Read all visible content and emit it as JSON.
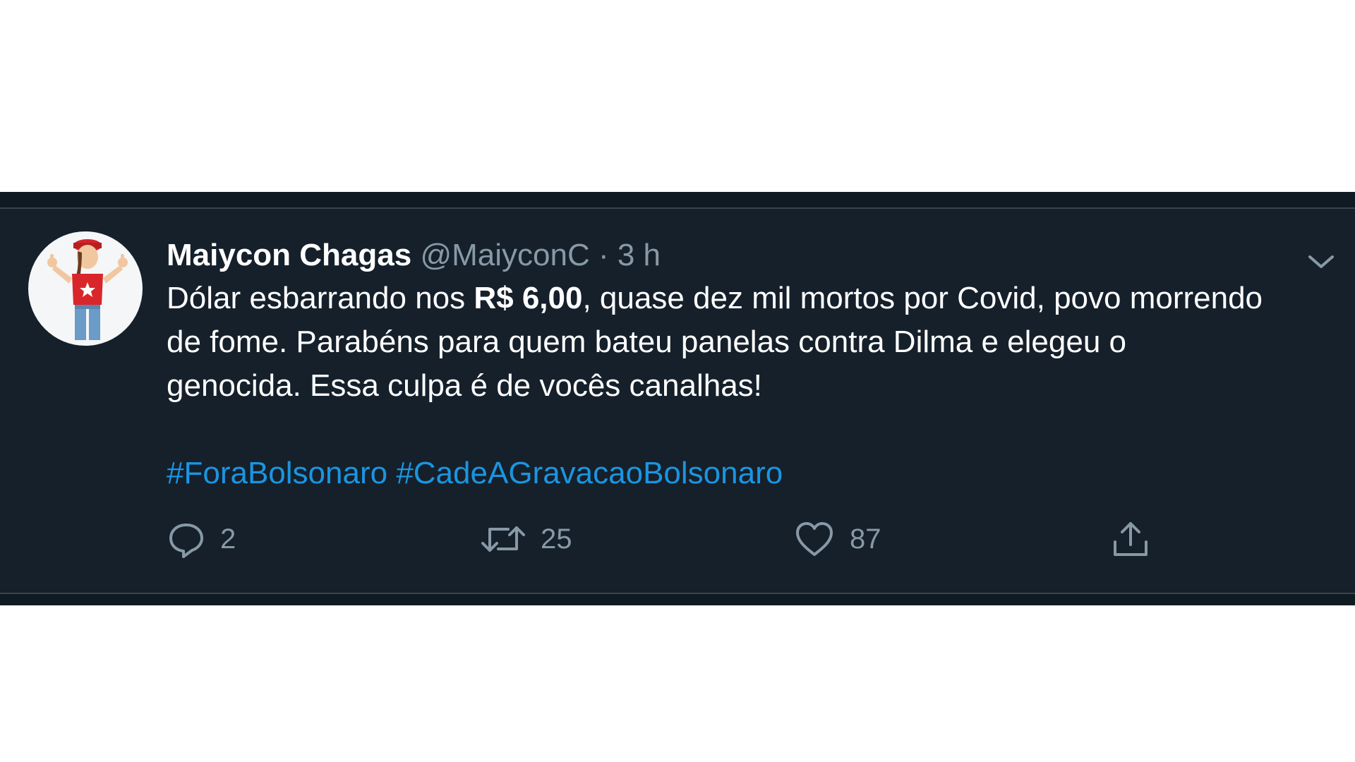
{
  "tweet": {
    "display_name": "Maiycon Chagas",
    "handle": "@MaiyconC",
    "separator": "·",
    "time": "3 h",
    "text_parts": {
      "p1": "Dólar esbarrando nos ",
      "bold": "R$ 6,00",
      "p2": ", quase dez mil mortos por Covid, povo morrendo de fome. Parabéns para quem bateu panelas contra Dilma e elegeu o genocida. Essa culpa é de vocês canalhas!"
    },
    "hashtags": [
      "#ForaBolsonaro",
      "#CadeAGravacaoBolsonaro"
    ],
    "actions": {
      "reply_count": "2",
      "retweet_count": "25",
      "like_count": "87"
    }
  },
  "icons": {
    "reply": "reply-icon",
    "retweet": "retweet-icon",
    "like": "heart-icon",
    "share": "share-icon",
    "more": "chevron-down-icon"
  },
  "colors": {
    "background": "#15202b",
    "text": "#ffffff",
    "secondary": "#8899a6",
    "link": "#1b95e0"
  }
}
